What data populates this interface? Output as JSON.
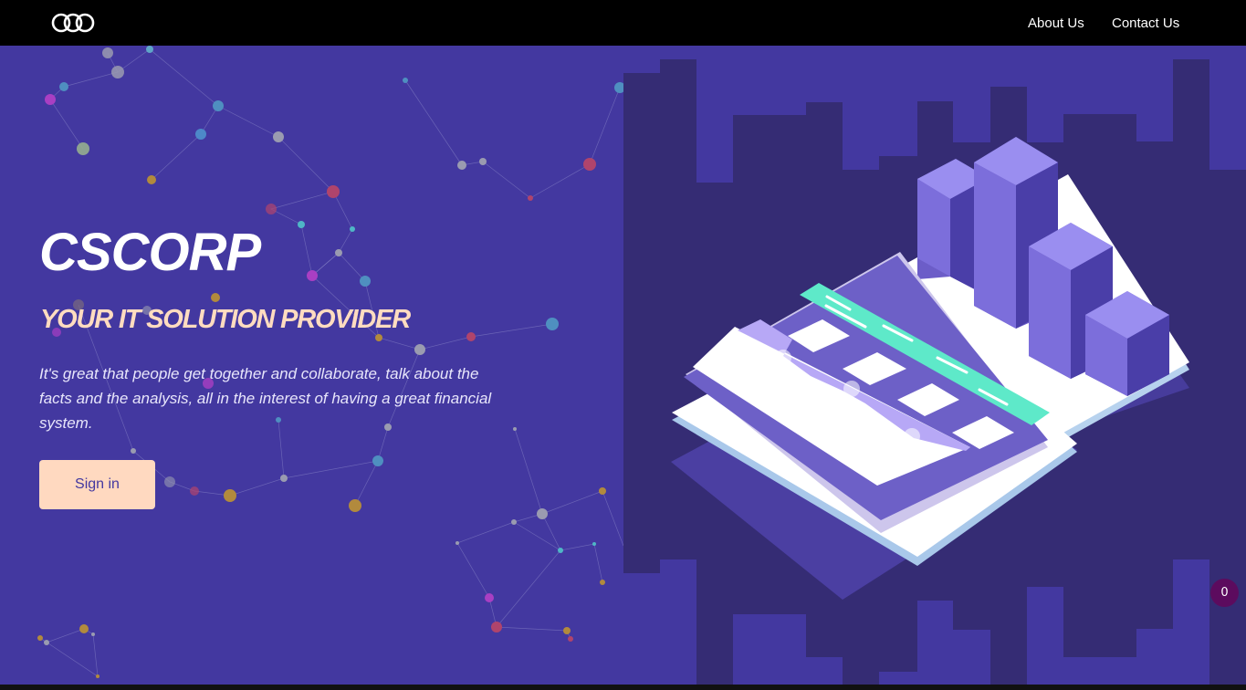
{
  "header": {
    "logo_alt": "CSCORP logo",
    "nav": [
      {
        "label": "About Us"
      },
      {
        "label": "Contact Us"
      }
    ]
  },
  "hero": {
    "brand": "CSCORP",
    "tagline": "YOUR IT SOLUTION PROVIDER",
    "description": "It's great that people get together and collaborate, talk about the facts and the analysis, all in the interest of having a great financial system.",
    "cta_label": "Sign in"
  },
  "widget": {
    "badge_count": "0"
  },
  "colors": {
    "hero_background": "#4338a0",
    "accent_peach": "#ffd9c0",
    "illustration_dark": "#352c74",
    "teal": "#5ee9c9",
    "badge": "#5c0b5e"
  },
  "icons": {
    "logo": "cscorp-logo-icon",
    "decoration": "network-nodes",
    "illustration": "isometric-dashboard"
  }
}
